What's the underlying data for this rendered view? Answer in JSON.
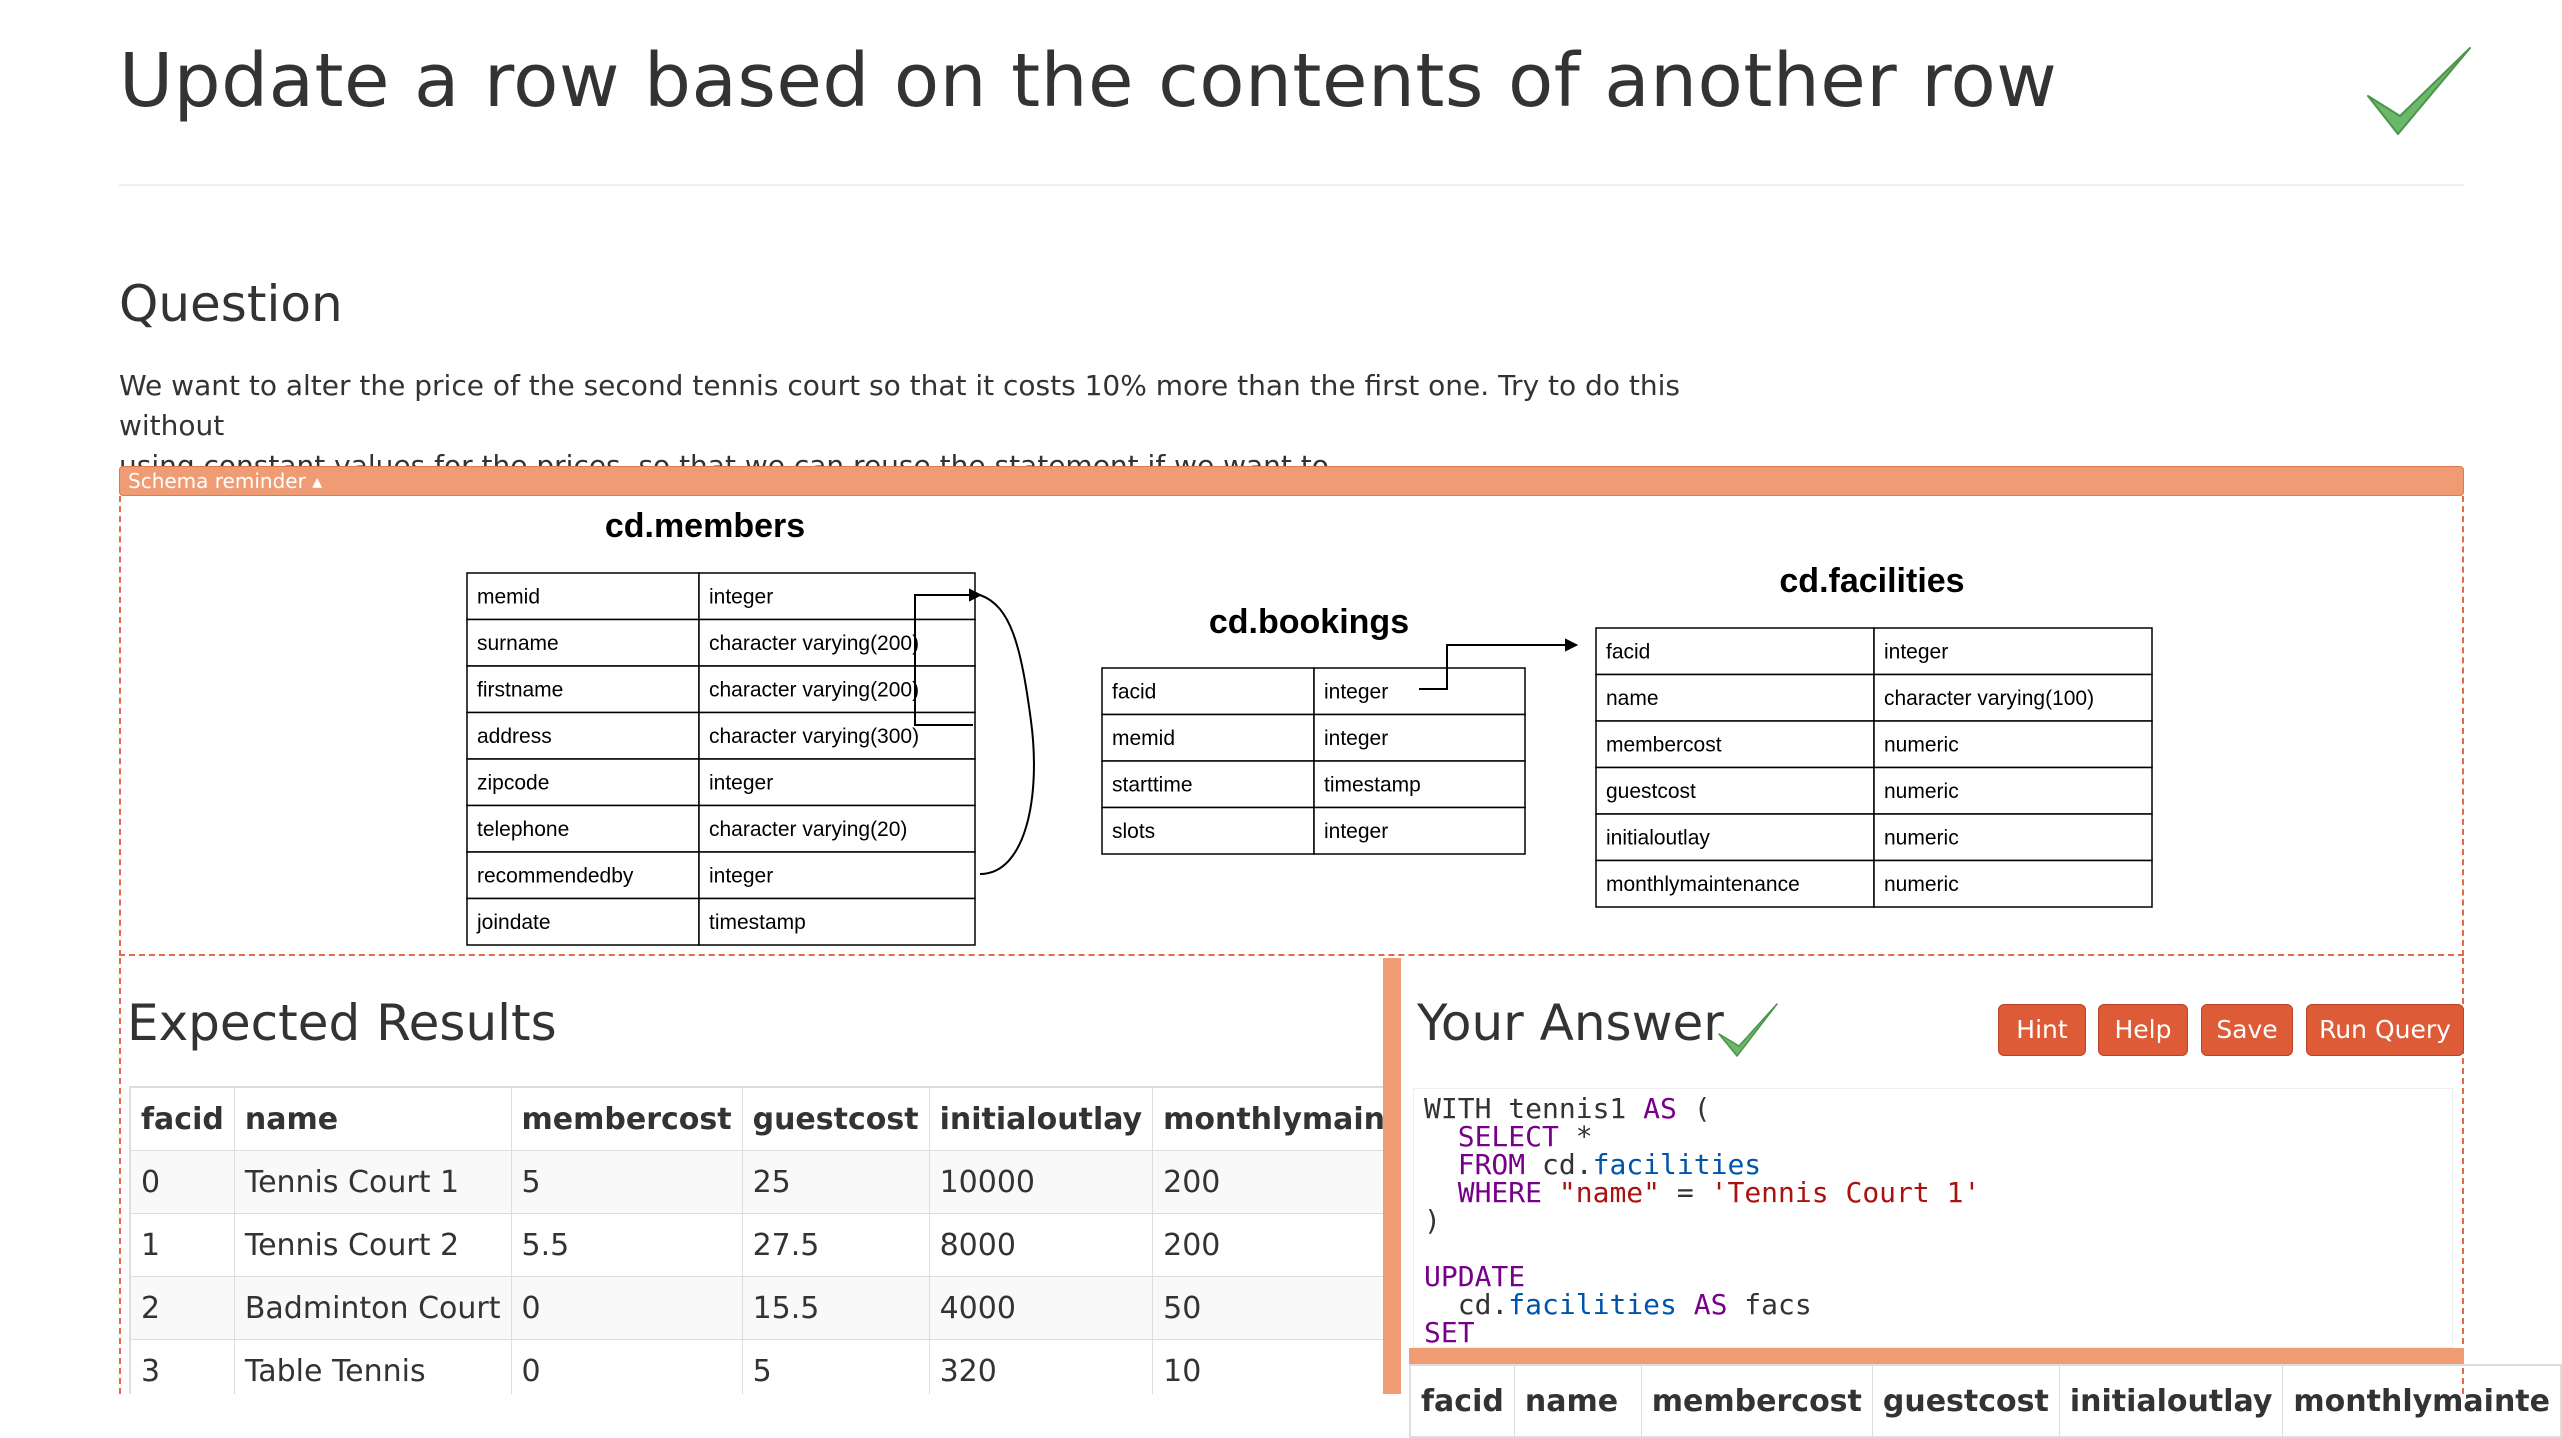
{
  "page": {
    "title": "Update a row based on the contents of another row"
  },
  "question": {
    "heading": "Question",
    "text_line1": "We want to alter the price of the second tennis court so that it costs 10% more than the first one. Try to do this without",
    "text_line2": "using constant values for the prices, so that we can reuse the statement if we want to."
  },
  "schema": {
    "toggle_label": "Schema reminder ▴",
    "tables": [
      {
        "name": "cd.members",
        "rows": [
          [
            "memid",
            "integer"
          ],
          [
            "surname",
            "character varying(200)"
          ],
          [
            "firstname",
            "character varying(200)"
          ],
          [
            "address",
            "character varying(300)"
          ],
          [
            "zipcode",
            "integer"
          ],
          [
            "telephone",
            "character varying(20)"
          ],
          [
            "recommendedby",
            "integer"
          ],
          [
            "joindate",
            "timestamp"
          ]
        ]
      },
      {
        "name": "cd.bookings",
        "rows": [
          [
            "facid",
            "integer"
          ],
          [
            "memid",
            "integer"
          ],
          [
            "starttime",
            "timestamp"
          ],
          [
            "slots",
            "integer"
          ]
        ]
      },
      {
        "name": "cd.facilities",
        "rows": [
          [
            "facid",
            "integer"
          ],
          [
            "name",
            "character varying(100)"
          ],
          [
            "membercost",
            "numeric"
          ],
          [
            "guestcost",
            "numeric"
          ],
          [
            "initialoutlay",
            "numeric"
          ],
          [
            "monthlymaintenance",
            "numeric"
          ]
        ]
      }
    ]
  },
  "expected": {
    "heading": "Expected Results",
    "columns": [
      "facid",
      "name",
      "membercost",
      "guestcost",
      "initialoutlay",
      "monthlymaintenance"
    ],
    "rows": [
      [
        "0",
        "Tennis Court 1",
        "5",
        "25",
        "10000",
        "200"
      ],
      [
        "1",
        "Tennis Court 2",
        "5.5",
        "27.5",
        "8000",
        "200"
      ],
      [
        "2",
        "Badminton Court",
        "0",
        "15.5",
        "4000",
        "50"
      ],
      [
        "3",
        "Table Tennis",
        "0",
        "5",
        "320",
        "10"
      ]
    ]
  },
  "answer": {
    "heading": "Your Answer",
    "buttons": {
      "hint": "Hint",
      "help": "Help",
      "save": "Save",
      "run": "Run Query"
    },
    "code": {
      "l1a": "WITH tennis1 ",
      "l1b": "AS",
      "l1c": " (",
      "l2a": "  ",
      "l2b": "SELECT",
      "l2c": " *",
      "l3a": "  ",
      "l3b": "FROM",
      "l3c": " cd.",
      "l3d": "facilities",
      "l4a": "  ",
      "l4b": "WHERE",
      "l4c": " ",
      "l4d": "\"name\"",
      "l4e": " = ",
      "l4f": "'Tennis Court 1'",
      "l5": ")",
      "l7": "UPDATE",
      "l8a": "  cd.",
      "l8b": "facilities",
      "l8c": " ",
      "l8d": "AS",
      "l8e": " facs",
      "l9": "SET"
    },
    "result_columns": [
      "facid",
      "name",
      "membercost",
      "guestcost",
      "initialoutlay",
      "monthlymainte"
    ]
  },
  "colors": {
    "accent": "#dd5b36",
    "accent_light": "#ef9c74",
    "check": "#6cb86a"
  }
}
